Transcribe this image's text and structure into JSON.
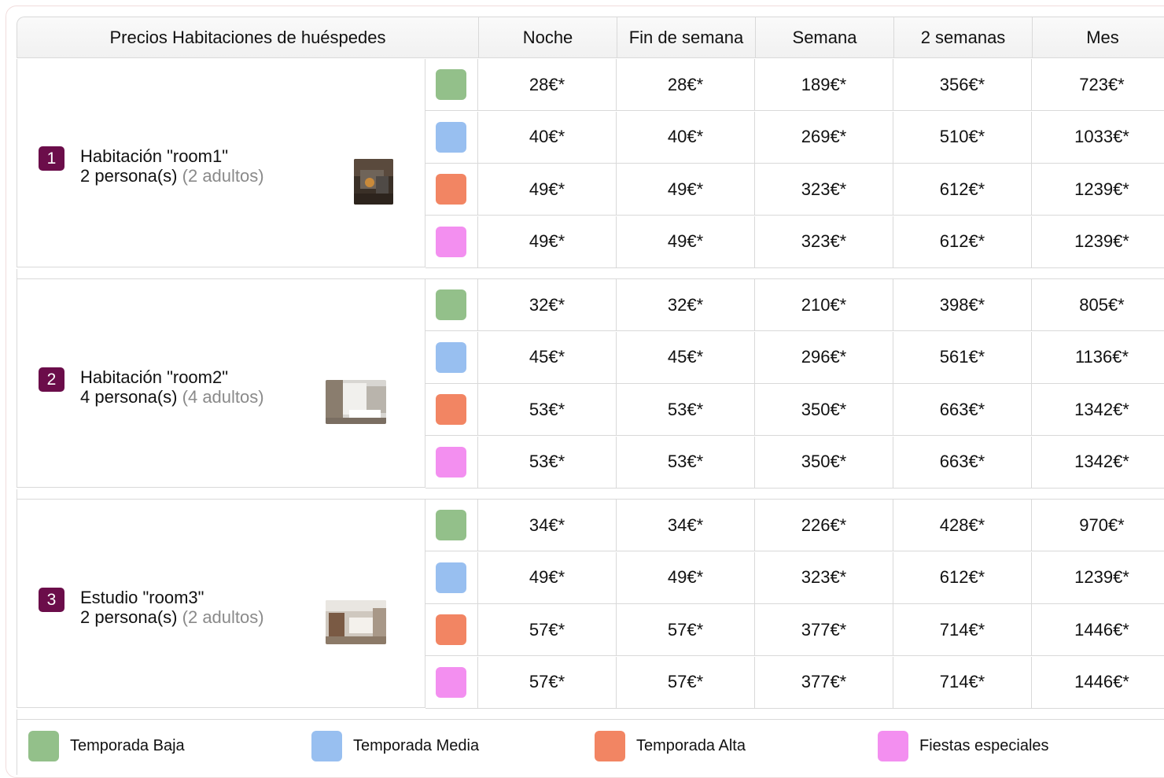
{
  "table": {
    "title": "Precios Habitaciones de huéspedes",
    "columns": [
      "Noche",
      "Fin de semana",
      "Semana",
      "2 semanas",
      "Mes"
    ]
  },
  "season_colors": [
    "#93c08a",
    "#98bff0",
    "#f28563",
    "#f38ff0"
  ],
  "rooms": [
    {
      "num": "1",
      "name": "Habitación \"room1\"",
      "persons": "2 persona(s)",
      "adults": "(2 adultos)",
      "rows": [
        [
          "28€*",
          "28€*",
          "189€*",
          "356€*",
          "723€*"
        ],
        [
          "40€*",
          "40€*",
          "269€*",
          "510€*",
          "1033€*"
        ],
        [
          "49€*",
          "49€*",
          "323€*",
          "612€*",
          "1239€*"
        ],
        [
          "49€*",
          "49€*",
          "323€*",
          "612€*",
          "1239€*"
        ]
      ]
    },
    {
      "num": "2",
      "name": "Habitación \"room2\"",
      "persons": "4 persona(s)",
      "adults": "(4 adultos)",
      "rows": [
        [
          "32€*",
          "32€*",
          "210€*",
          "398€*",
          "805€*"
        ],
        [
          "45€*",
          "45€*",
          "296€*",
          "561€*",
          "1136€*"
        ],
        [
          "53€*",
          "53€*",
          "350€*",
          "663€*",
          "1342€*"
        ],
        [
          "53€*",
          "53€*",
          "350€*",
          "663€*",
          "1342€*"
        ]
      ]
    },
    {
      "num": "3",
      "name": "Estudio \"room3\"",
      "persons": "2 persona(s)",
      "adults": "(2 adultos)",
      "rows": [
        [
          "34€*",
          "34€*",
          "226€*",
          "428€*",
          "970€*"
        ],
        [
          "49€*",
          "49€*",
          "323€*",
          "612€*",
          "1239€*"
        ],
        [
          "57€*",
          "57€*",
          "377€*",
          "714€*",
          "1446€*"
        ],
        [
          "57€*",
          "57€*",
          "377€*",
          "714€*",
          "1446€*"
        ]
      ]
    }
  ],
  "legend": [
    {
      "label": "Temporada Baja",
      "color": "#93c08a"
    },
    {
      "label": "Temporada Media",
      "color": "#98bff0"
    },
    {
      "label": "Temporada Alta",
      "color": "#f28563"
    },
    {
      "label": "Fiestas especiales",
      "color": "#f38ff0"
    }
  ]
}
